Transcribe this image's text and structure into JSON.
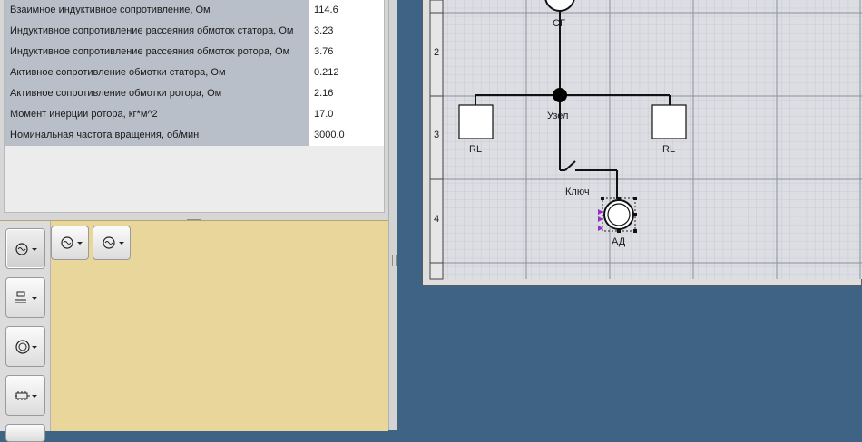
{
  "properties": [
    {
      "name": "Взаимное индуктивное сопротивление, Ом",
      "value": "114.6"
    },
    {
      "name": "Индуктивное сопротивление рассеяния обмоток статора, Ом",
      "value": "3.23"
    },
    {
      "name": "Индуктивное сопротивление рассеяния обмоток ротора, Ом",
      "value": "3.76"
    },
    {
      "name": "Активное сопротивление обмотки статора, Ом",
      "value": "0.212"
    },
    {
      "name": "Активное сопротивление обмотки ротора, Ом",
      "value": "2.16"
    },
    {
      "name": "Момент инерции ротора, кг*м^2",
      "value": "17.0"
    },
    {
      "name": "Номинальная частота вращения, об/мин",
      "value": "3000.0"
    }
  ],
  "palette": {
    "categories": [
      {
        "icon": "generator-icon",
        "selected": true
      },
      {
        "icon": "load-icon",
        "selected": false
      },
      {
        "icon": "transformer-icon",
        "selected": false
      },
      {
        "icon": "line-icon",
        "selected": false
      }
    ],
    "sub_items": [
      {
        "icon": "generator-icon"
      },
      {
        "icon": "generator-alt-icon"
      }
    ]
  },
  "diagram": {
    "ruler_labels": [
      "2",
      "3",
      "4"
    ],
    "generator_label": "СГ",
    "node_label": "Узел",
    "load_left_label": "RL",
    "load_right_label": "RL",
    "switch_label": "Ключ",
    "motor_label": "АД"
  },
  "colors": {
    "workspace_bg": "#3f6384",
    "palette_bg": "#e8d69a",
    "property_name_bg": "#b8bfc8",
    "grid_bg": "#dcdee3",
    "selection_handle": "#9b30c8"
  }
}
